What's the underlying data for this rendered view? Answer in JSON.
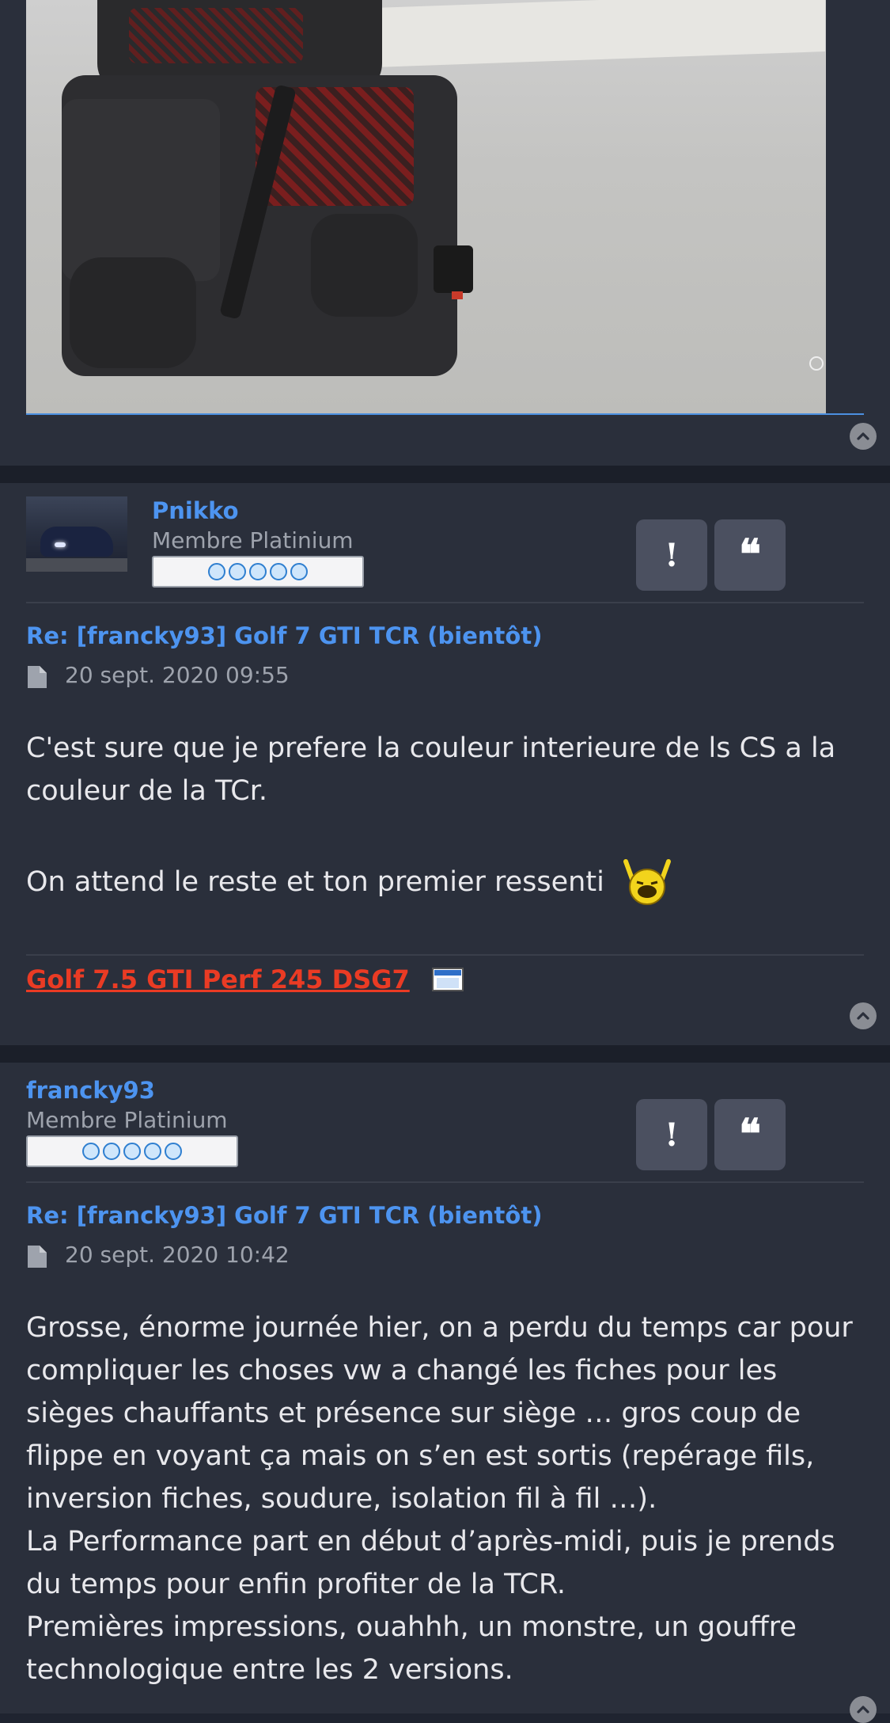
{
  "posts": [
    {
      "username": "Pnikko",
      "rank": "Membre Platinium",
      "title": "Re: [francky93] Golf 7 GTI TCR (bientôt)",
      "date": "20 sept. 2020 09:55",
      "body": [
        "C'est sure que je prefere la couleur interieure de ls CS a la couleur de la TCr.",
        "On attend le reste et ton premier ressenti"
      ],
      "signature": "Golf 7.5 GTI Perf 245 DSG7"
    },
    {
      "username": "francky93",
      "rank": "Membre Platinium",
      "title": "Re: [francky93] Golf 7 GTI TCR (bientôt)",
      "date": "20 sept. 2020 10:42",
      "body": [
        "Grosse, énorme journée hier, on a perdu du temps car pour compliquer les choses vw a changé les fiches pour les sièges chauffants et présence sur siège … gros coup de flippe en voyant ça mais on s’en est sortis (repérage fils, inversion fiches, soudure, isolation fil à fil …).",
        "La Performance part en début d’après-midi, puis je prends du temps pour enfin profiter de la TCR.",
        "Premières impressions, ouahhh, un monstre, un gouffre technologique entre les 2 versions."
      ]
    }
  ],
  "buttons": {
    "report_glyph": "!",
    "quote_glyph": "❝"
  },
  "icons": {
    "scroll_top": "chevron-up-icon",
    "post_date": "file-icon",
    "smiley": "cheering-smiley-icon",
    "signature": "window-icon"
  },
  "colors": {
    "background": "#1f2430",
    "panel": "#2a2f3b",
    "link": "#4d94f0",
    "signature": "#ea3b24"
  }
}
